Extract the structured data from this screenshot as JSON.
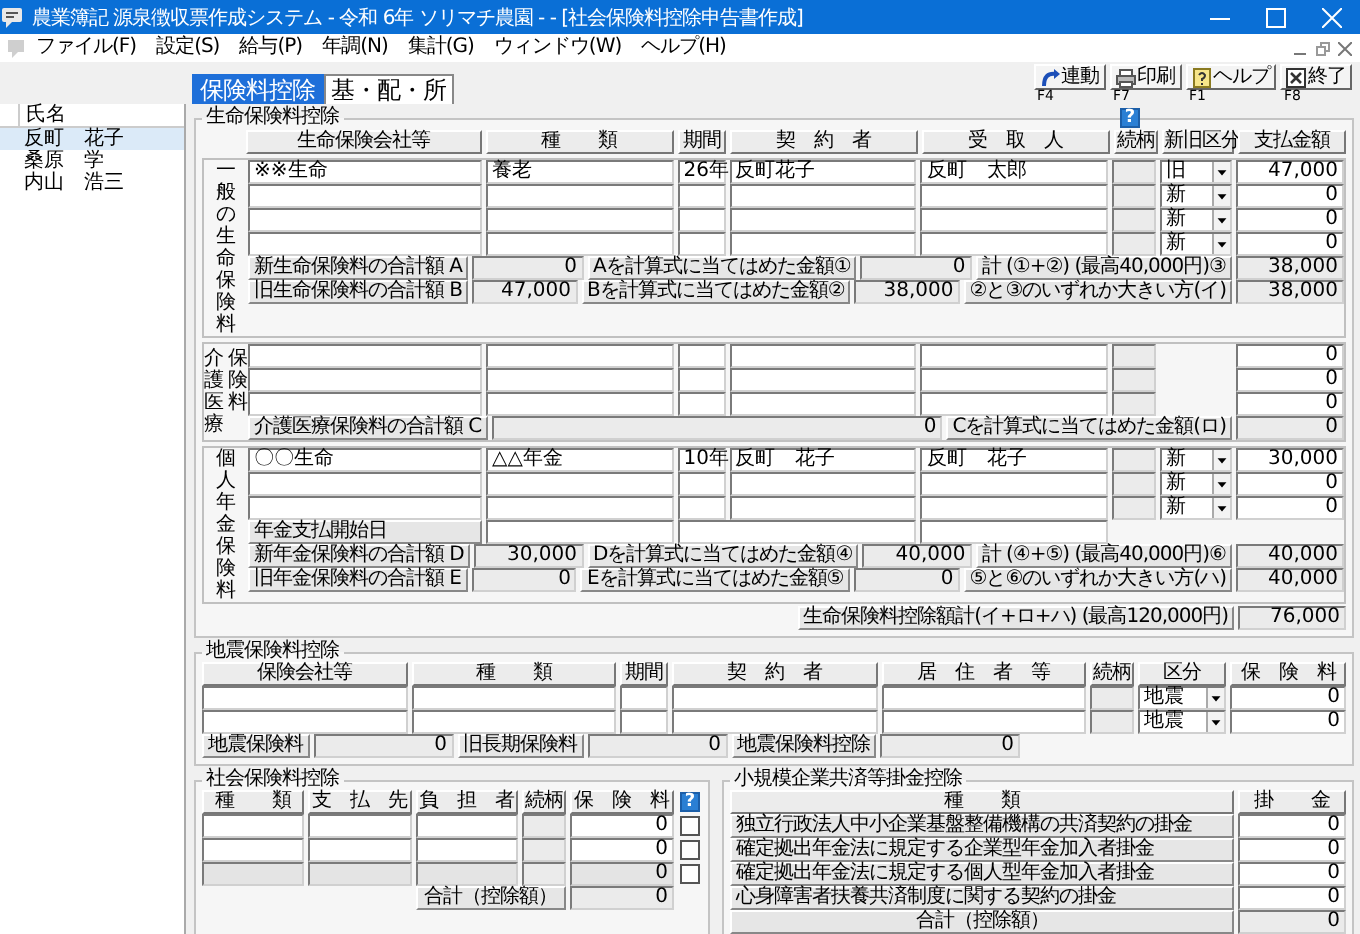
{
  "window": {
    "title": "農業簿記 源泉徴収票作成システム - 令和 6年 ソリマチ農園 - - [社会保険料控除申告書作成]"
  },
  "menu": [
    "ファイル(F)",
    "設定(S)",
    "給与(P)",
    "年調(N)",
    "集計(G)",
    "ウィンドウ(W)",
    "ヘルプ(H)"
  ],
  "toolbar": [
    {
      "kind": "link",
      "label": "連動",
      "key": "F4"
    },
    {
      "kind": "print",
      "label": "印刷",
      "key": "F7"
    },
    {
      "kind": "help",
      "label": "ヘルプ",
      "key": "F1"
    },
    {
      "kind": "exit",
      "label": "終了",
      "key": "F8"
    }
  ],
  "sidebar": {
    "header": "氏名",
    "items": [
      {
        "name": "反町　花子",
        "selected": true
      },
      {
        "name": "桑原　学",
        "selected": false
      },
      {
        "name": "内山　浩三",
        "selected": false
      }
    ]
  },
  "tabs": [
    {
      "label": "保険料控除",
      "selected": true
    },
    {
      "label": "基・配・所",
      "selected": false
    }
  ],
  "life_insurance": {
    "title": "生命保険料控除",
    "help": "?",
    "columns": [
      "生命保険会社等",
      "種　　類",
      "期間",
      "契　約　者",
      "受　取　人",
      "続柄",
      "新旧区分",
      "支払金額"
    ],
    "groups": [
      {
        "kind": "general",
        "label": "一般の生命保険料",
        "rows": [
          {
            "company": "※※生命",
            "type": "養老",
            "period": "26年",
            "contractor": "反町花子",
            "recipient": "反町　太郎",
            "category": "旧",
            "amount": "47,000"
          },
          {
            "category": "新",
            "amount": "0"
          },
          {
            "category": "新",
            "amount": "0"
          },
          {
            "category": "新",
            "amount": "0"
          }
        ],
        "summary": [
          [
            "新生命保険料の合計額 A",
            "0",
            "Aを計算式に当てはめた金額①",
            "0",
            "計 (①+②) (最高40,000円)③",
            "38,000"
          ],
          [
            "旧生命保険料の合計額 B",
            "47,000",
            "Bを計算式に当てはめた金額②",
            "38,000",
            "②と③のいずれか大きい方(イ)",
            "38,000"
          ]
        ]
      },
      {
        "kind": "care",
        "label": "介護医療保険料",
        "rows": [
          {
            "amount": "0"
          },
          {
            "amount": "0"
          },
          {
            "amount": "0"
          }
        ],
        "summary": [
          [
            "介護医療保険料の合計額 C",
            "0",
            "Cを計算式に当てはめた金額(ロ)",
            "0"
          ]
        ]
      },
      {
        "kind": "pension",
        "label": "個人年金保険料",
        "rows": [
          {
            "company": "〇〇生命",
            "type": "△△年金",
            "period": "10年",
            "contractor": "反町　花子",
            "recipient": "反町　花子",
            "category": "新",
            "amount": "30,000"
          },
          {
            "category": "新",
            "amount": "0"
          },
          {
            "category": "新",
            "amount": "0"
          }
        ],
        "start_date_label": "年金支払開始日",
        "summary": [
          [
            "新年金保険料の合計額 D",
            "30,000",
            "Dを計算式に当てはめた金額④",
            "40,000",
            "計 (④+⑤) (最高40,000円)⑥",
            "40,000"
          ],
          [
            "旧年金保険料の合計額 E",
            "0",
            "Eを計算式に当てはめた金額⑤",
            "0",
            "⑤と⑥のいずれか大きい方(ハ)",
            "40,000"
          ]
        ]
      }
    ],
    "total": {
      "label": "生命保険料控除額計(イ+ロ+ハ) (最高120,000円)",
      "value": "76,000"
    }
  },
  "earthquake": {
    "title": "地震保険料控除",
    "columns": [
      "保険会社等",
      "種　　類",
      "期間",
      "契　約　者",
      "居　住　者　等",
      "続柄",
      "区分",
      "保　険　料"
    ],
    "rows": [
      {
        "category": "地震",
        "amount": "0"
      },
      {
        "category": "地震",
        "amount": "0"
      }
    ],
    "totals": [
      "地震保険料",
      "0",
      "旧長期保険料",
      "0",
      "地震保険料控除",
      "0"
    ]
  },
  "social_insurance": {
    "title": "社会保険料控除",
    "help": "?",
    "columns": [
      "種　　類",
      "支　払　先",
      "負　担　者",
      "続柄",
      "保　険　料"
    ],
    "rows": [
      {
        "amount": "0",
        "checked": false,
        "disabled": false
      },
      {
        "amount": "0",
        "checked": false,
        "disabled": false
      },
      {
        "amount": "0",
        "checked": false,
        "disabled": true
      }
    ],
    "total": {
      "label": "合計（控除額）",
      "value": "0"
    }
  },
  "small_business": {
    "title": "小規模企業共済等掛金控除",
    "columns": [
      "種　　類",
      "掛　　金"
    ],
    "rows": [
      {
        "label": "独立行政法人中小企業基盤整備機構の共済契約の掛金",
        "amount": "0"
      },
      {
        "label": "確定拠出年金法に規定する企業型年金加入者掛金",
        "amount": "0"
      },
      {
        "label": "確定拠出年金法に規定する個人型年金加入者掛金",
        "amount": "0"
      },
      {
        "label": "心身障害者扶養共済制度に関する契約の掛金",
        "amount": "0"
      }
    ],
    "total": {
      "label": "合計（控除額）",
      "value": "0"
    }
  }
}
